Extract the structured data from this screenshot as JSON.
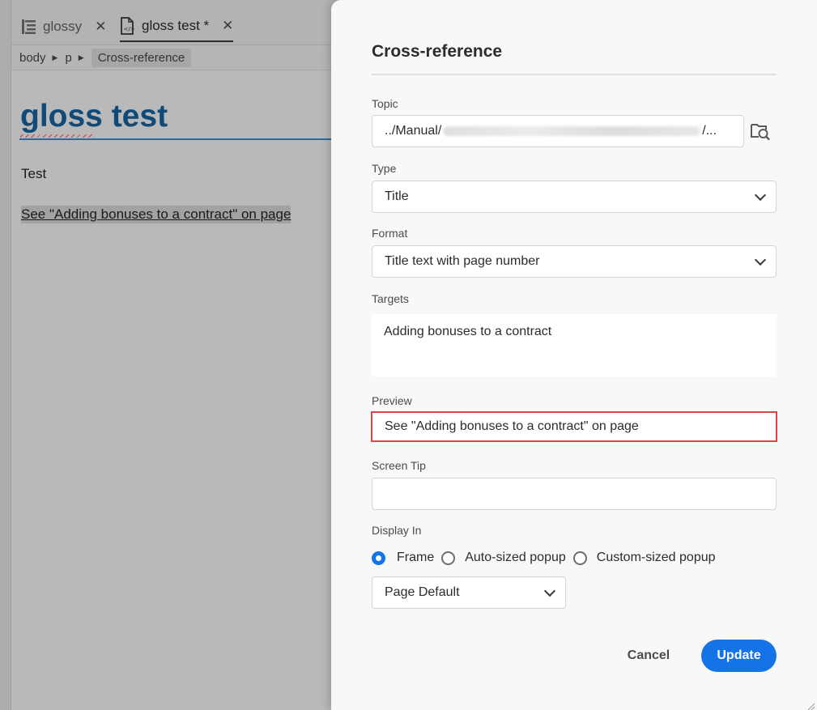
{
  "tabs": [
    {
      "label": "glossy",
      "close": "✕",
      "icon": "toc-icon",
      "active": false
    },
    {
      "label": "gloss test *",
      "close": "✕",
      "icon": "html-file-icon",
      "active": true
    }
  ],
  "breadcrumb": [
    "body",
    "p",
    "Cross-reference"
  ],
  "document": {
    "title": "gloss test",
    "paragraph": "Test",
    "xref_text": "See \"Adding bonuses to a contract\" on page"
  },
  "dialog": {
    "title": "Cross-reference",
    "topic_label": "Topic",
    "topic_value_start": "../Manual/",
    "topic_value_end": "/...",
    "type_label": "Type",
    "type_value": "Title",
    "format_label": "Format",
    "format_value": "Title text with page number",
    "targets_label": "Targets",
    "targets_value": "Adding bonuses to a contract",
    "preview_label": "Preview",
    "preview_value": "See \"Adding bonuses to a contract\" on page",
    "screentip_label": "Screen Tip",
    "screentip_value": "",
    "display_in_label": "Display In",
    "display_options": [
      {
        "label": "Frame",
        "checked": true
      },
      {
        "label": "Auto-sized popup",
        "checked": false
      },
      {
        "label": "Custom-sized popup",
        "checked": false
      }
    ],
    "page_default_value": "Page Default",
    "cancel_label": "Cancel",
    "update_label": "Update"
  },
  "colors": {
    "accent": "#1473e6",
    "highlight_border": "#d9464a",
    "title_blue": "#0f4a78"
  }
}
